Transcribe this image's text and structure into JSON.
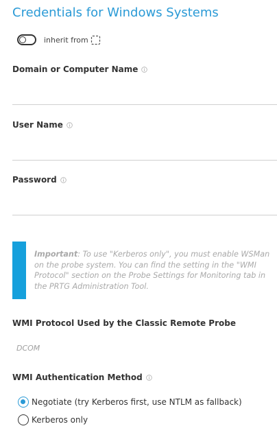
{
  "section_title": "Credentials for Windows Systems",
  "inherit": {
    "label": "inherit from",
    "enabled": false
  },
  "fields": {
    "domain": {
      "label": "Domain or Computer Name",
      "value": ""
    },
    "username": {
      "label": "User Name",
      "value": ""
    },
    "password": {
      "label": "Password",
      "value": ""
    }
  },
  "note": {
    "strong": "Important",
    "text": ": To use \"Kerberos only\", you must enable WSMan on the probe system. You can find the setting in the \"WMI Protocol\" section on the Probe Settings for Monitoring tab in the PRTG Administration Tool.",
    "accent_color": "#16a0dc"
  },
  "wmi_protocol": {
    "label": "WMI Protocol Used by the Classic Remote Probe",
    "value": "DCOM"
  },
  "wmi_auth": {
    "label": "WMI Authentication Method",
    "options": [
      {
        "label": "Negotiate (try Kerberos first, use NTLM as fallback)",
        "selected": true
      },
      {
        "label": "Kerberos only",
        "selected": false
      }
    ]
  },
  "colors": {
    "title": "#2a9ad6",
    "radio_selected": "#2a9ad6"
  },
  "icons": {
    "info": "info-circle-icon",
    "inherit": "dashed-square-icon"
  }
}
